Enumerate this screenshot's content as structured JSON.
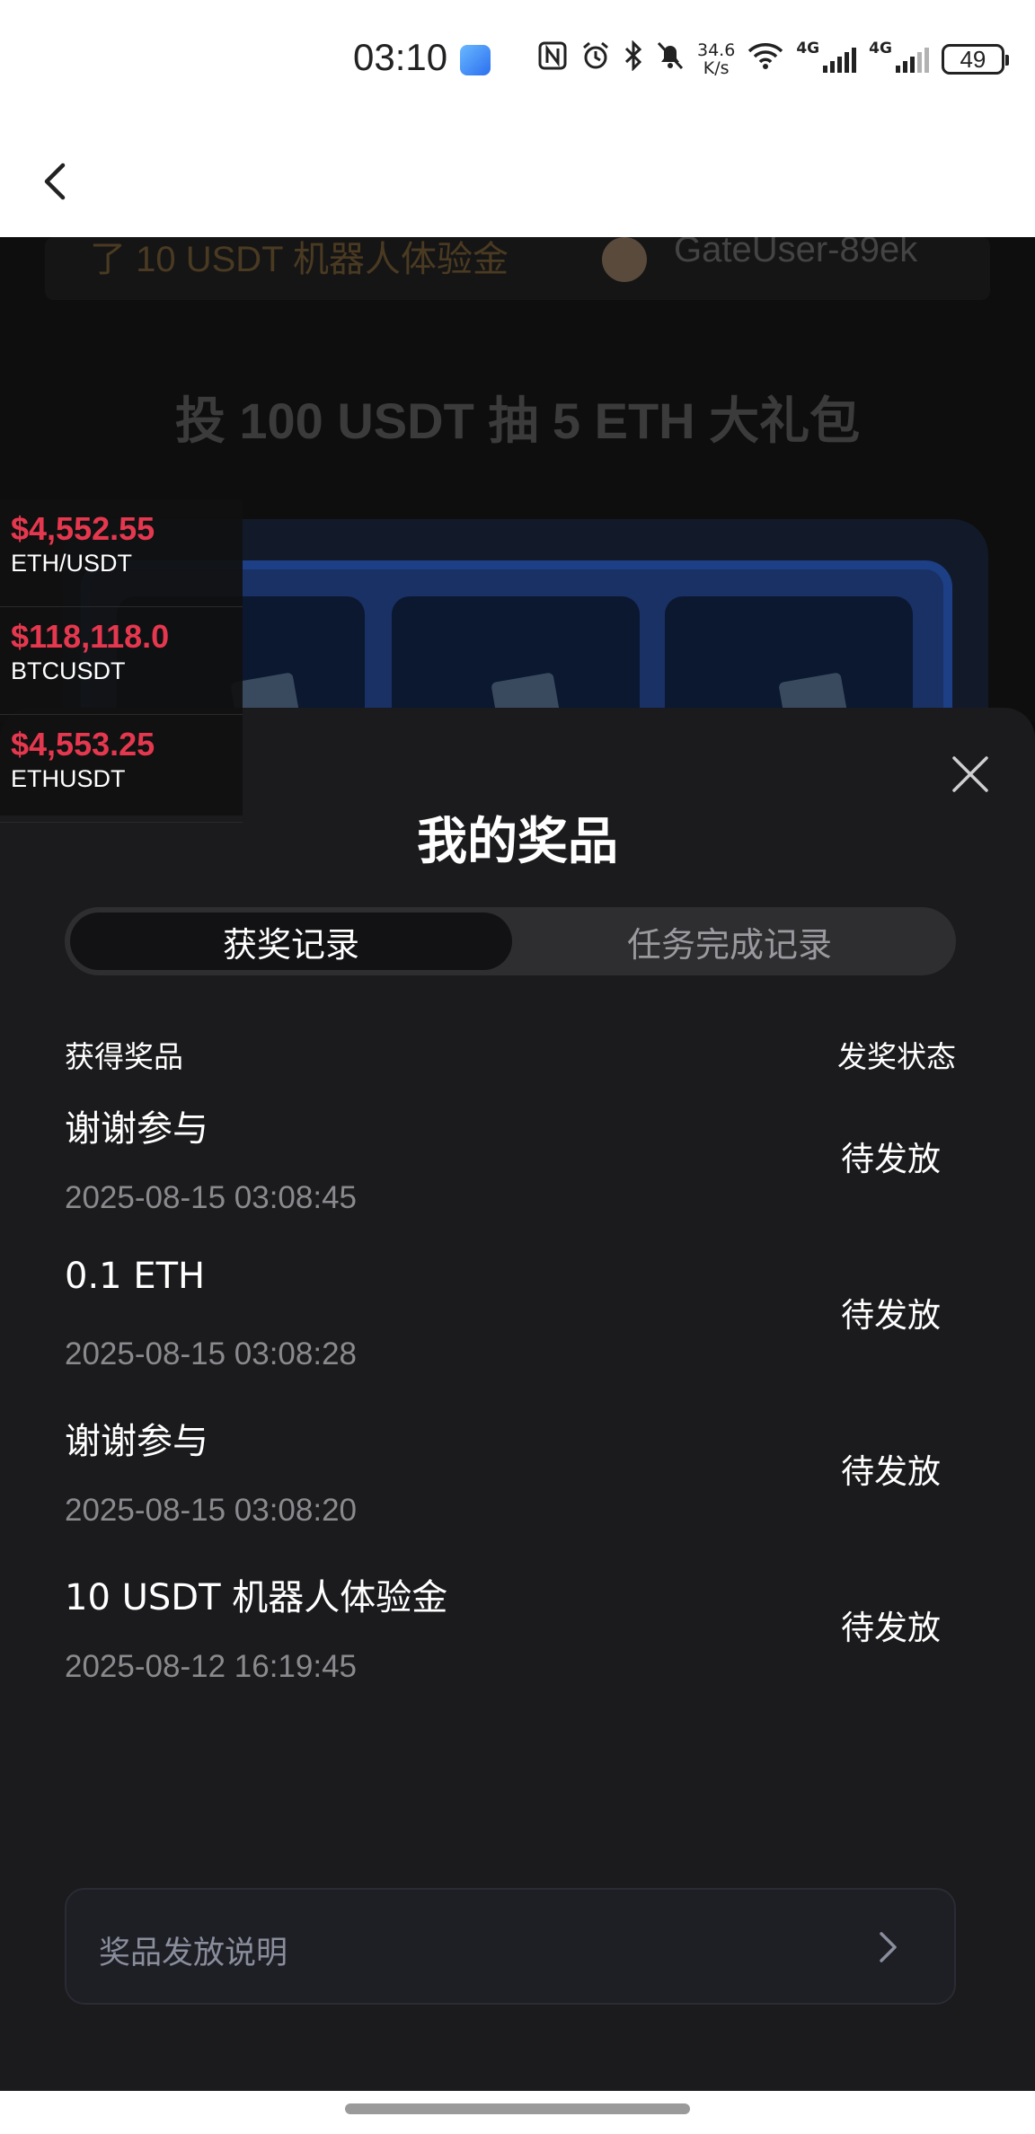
{
  "status_bar": {
    "time": "03:10",
    "net_speed_value": "34.6",
    "net_speed_unit": "K/s",
    "network_1": "4G",
    "network_2": "4G",
    "battery": "49",
    "icons": [
      "nfc-icon",
      "alarm-icon",
      "bluetooth-icon",
      "mute-icon",
      "wifi-icon",
      "signal-icon",
      "signal-icon",
      "battery-icon"
    ]
  },
  "header": {
    "back_icon": "chevron-left-icon"
  },
  "background": {
    "banner_text": "了 10 USDT 机器人体验金",
    "banner_user": "GateUser-89ek",
    "promo_title": "投 100 USDT 抽 5 ETH 大礼包"
  },
  "ticker": [
    {
      "price": "$4,552.55",
      "pair": "ETH/USDT"
    },
    {
      "price": "$118,118.0",
      "pair": "BTCUSDT"
    },
    {
      "price": "$4,553.25",
      "pair": "ETHUSDT"
    }
  ],
  "sheet": {
    "title": "我的奖品",
    "close_icon": "close-icon",
    "tabs": [
      {
        "label": "获奖记录",
        "active": true
      },
      {
        "label": "任务完成记录",
        "active": false
      }
    ],
    "columns": {
      "prize": "获得奖品",
      "status": "发奖状态"
    },
    "records": [
      {
        "name": "谢谢参与",
        "time": "2025-08-15 03:08:45",
        "status": "待发放"
      },
      {
        "name": "0.1 ETH",
        "time": "2025-08-15 03:08:28",
        "status": "待发放"
      },
      {
        "name": "谢谢参与",
        "time": "2025-08-15 03:08:20",
        "status": "待发放"
      },
      {
        "name": "10 USDT 机器人体验金",
        "time": "2025-08-12 16:19:45",
        "status": "待发放"
      }
    ],
    "info": {
      "label": "奖品发放说明",
      "icon": "chevron-right-icon"
    }
  },
  "colors": {
    "sheet_bg": "#1b1b1d",
    "ticker_price": "#e5384f",
    "muted_text": "#8a8a8e"
  }
}
